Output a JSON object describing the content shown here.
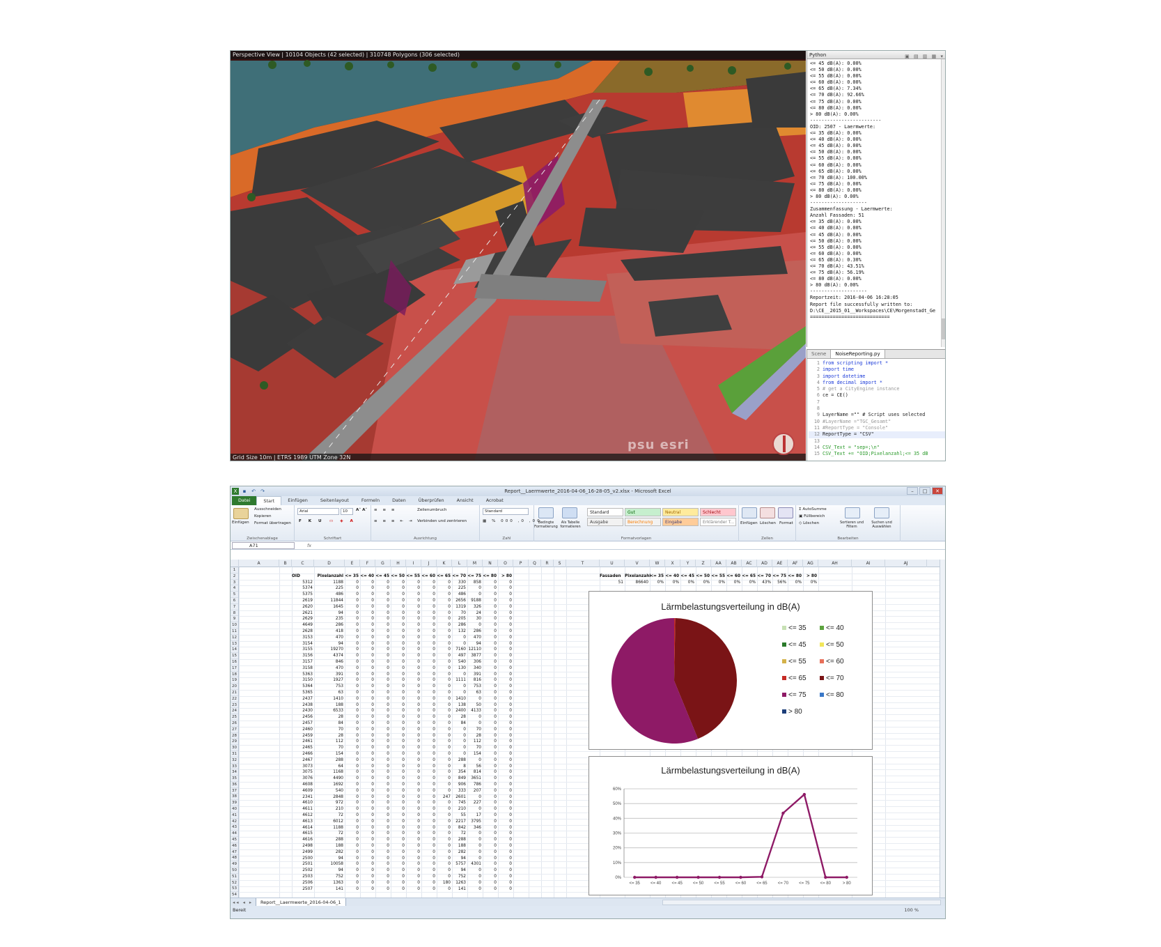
{
  "viewer": {
    "title": "Perspective View  |  10104 Objects  (42 selected)  |  310748 Polygons  (306 selected)",
    "status": "Grid Size 10m  |  ETRS 1989 UTM Zone 32N",
    "watermark": "psu  esri",
    "python_console": {
      "header": "Python",
      "lines": [
        "<= 45 dB(A): 0.00%",
        "<= 50 dB(A): 0.00%",
        "<= 55 dB(A): 0.00%",
        "<= 60 dB(A): 0.00%",
        "<= 65 dB(A): 7.34%",
        "<= 70 dB(A): 92.66%",
        "<= 75 dB(A): 0.00%",
        "<= 80 dB(A): 0.00%",
        "> 80 dB(A): 0.00%",
        "-------------------------",
        "OID: 2507 - Laermwerte:",
        "<= 35 dB(A): 0.00%",
        "<= 40 dB(A): 0.00%",
        "<= 45 dB(A): 0.00%",
        "<= 50 dB(A): 0.00%",
        "<= 55 dB(A): 0.00%",
        "<= 60 dB(A): 0.00%",
        "<= 65 dB(A): 0.00%",
        "<= 70 dB(A): 100.00%",
        "<= 75 dB(A): 0.00%",
        "<= 80 dB(A): 0.00%",
        "> 80 dB(A): 0.00%",
        "--------------------",
        "",
        "Zusammenfassung - Laermwerte:",
        "",
        "Anzahl Fassaden: 51",
        "<= 35 dB(A): 0.00%",
        "<= 40 dB(A): 0.00%",
        "<= 45 dB(A): 0.00%",
        "<= 50 dB(A): 0.00%",
        "<= 55 dB(A): 0.00%",
        "<= 60 dB(A): 0.00%",
        "<= 65 dB(A): 0.30%",
        "<= 70 dB(A): 43.51%",
        "<= 75 dB(A): 56.19%",
        "<= 80 dB(A): 0.00%",
        "> 80 dB(A): 0.00%",
        "--------------------",
        "",
        "Reportzeit: 2016-04-06 16:28:05",
        "",
        "Report file successfully written to:",
        "D:\\CE__2015_01__Workspaces\\CE\\Morgenstadt_Ge",
        "============================"
      ]
    },
    "script_editor": {
      "tabs": [
        "Scene",
        "NoiseReporting.py"
      ],
      "lines": [
        {
          "n": "1",
          "text": "from scripting import *",
          "kind": "kw"
        },
        {
          "n": "2",
          "text": "import time",
          "kind": "kw"
        },
        {
          "n": "3",
          "text": "import datetime",
          "kind": "kw"
        },
        {
          "n": "4",
          "text": "from decimal import *",
          "kind": "kw"
        },
        {
          "n": "5",
          "text": "# get a CityEngine instance",
          "kind": "cm"
        },
        {
          "n": "6",
          "text": "ce = CE()",
          "kind": ""
        },
        {
          "n": "7",
          "text": "",
          "kind": ""
        },
        {
          "n": "8",
          "text": "",
          "kind": ""
        },
        {
          "n": "9",
          "text": "LayerName =\"\" # Script uses selected",
          "kind": ""
        },
        {
          "n": "10",
          "text": "#LayerName =\"TGC_Gesamt\"",
          "kind": "cm"
        },
        {
          "n": "11",
          "text": "#ReportType = \"Console\"",
          "kind": "cm"
        },
        {
          "n": "12",
          "text": "ReportType = \"CSV\"",
          "kind": "hl"
        },
        {
          "n": "13",
          "text": "",
          "kind": ""
        },
        {
          "n": "14",
          "text": "CSV_Text = \"sep=;\\n\"",
          "kind": "st"
        },
        {
          "n": "15",
          "text": "CSV_Text += \"OID;Pixelanzahl;<= 35 dB",
          "kind": "st"
        }
      ]
    }
  },
  "excel": {
    "window_title": "Report__Laermwerte_2016-04-06_16-28-05_v2.xlsx - Microsoft Excel",
    "ribbon_tabs": [
      "Datei",
      "Start",
      "Einfügen",
      "Seitenlayout",
      "Formeln",
      "Daten",
      "Überprüfen",
      "Ansicht",
      "Acrobat"
    ],
    "ribbon": {
      "clipboard": {
        "paste": "Einfügen",
        "cut": "Ausschneiden",
        "copy": "Kopieren",
        "format": "Format übertragen",
        "label": "Zwischenablage"
      },
      "font": {
        "name": "Arial",
        "size": "10",
        "label": "Schriftart"
      },
      "alignment": {
        "wrap": "Zeilenumbruch",
        "merge": "Verbinden und zentrieren",
        "label": "Ausrichtung"
      },
      "number": {
        "format": "Standard",
        "label": "Zahl"
      },
      "styles": {
        "cond": "Bedingte Formatierung",
        "table": "Als Tabelle formatieren",
        "label": "Formatvorlagen",
        "boxes": [
          {
            "text": "Standard",
            "bg": "#ffffff",
            "fg": "#222222"
          },
          {
            "text": "Gut",
            "bg": "#c6efce",
            "fg": "#006100"
          },
          {
            "text": "Neutral",
            "bg": "#ffeb9c",
            "fg": "#9c6500"
          },
          {
            "text": "Schlecht",
            "bg": "#ffc7ce",
            "fg": "#9c0006"
          },
          {
            "text": "Ausgabe",
            "bg": "#f2f2f2",
            "fg": "#3f3f3f"
          },
          {
            "text": "Berechnung",
            "bg": "#f2f2f2",
            "fg": "#fa7d00"
          },
          {
            "text": "Eingabe",
            "bg": "#ffcc99",
            "fg": "#3f3f76"
          },
          {
            "text": "Erklärender T...",
            "bg": "#ffffff",
            "fg": "#7f7f7f"
          }
        ]
      },
      "cells": {
        "insert": "Einfügen",
        "delete": "Löschen",
        "format": "Format",
        "label": "Zellen"
      },
      "editing": {
        "autosum": "AutoSumme",
        "fill": "Füllbereich",
        "clear": "Löschen",
        "sort": "Sortieren und Filtern",
        "find": "Suchen und Auswählen",
        "label": "Bearbeiten"
      }
    },
    "name_box": "A71",
    "fx": "fx",
    "columns": [
      "A",
      "B",
      "C",
      "D",
      "E",
      "F",
      "G",
      "H",
      "I",
      "J",
      "K",
      "L",
      "M",
      "N",
      "O",
      "P",
      "Q",
      "R",
      "S",
      "T",
      "U",
      "V",
      "W",
      "X",
      "Y",
      "Z",
      "AA",
      "AB",
      "AC",
      "AD",
      "AE",
      "AF",
      "AG",
      "AH",
      "AI",
      "AJ"
    ],
    "table_headers": [
      "OID",
      "Pixelanzahl",
      "<= 35",
      "<= 40",
      "<= 45",
      "<= 50",
      "<= 55",
      "<= 60",
      "<= 65",
      "<= 70",
      "<= 75",
      "<= 80",
      "> 80"
    ],
    "rows": [
      [
        5312,
        1188,
        0,
        0,
        0,
        0,
        0,
        0,
        0,
        330,
        858,
        0,
        0
      ],
      [
        5374,
        225,
        0,
        0,
        0,
        0,
        0,
        0,
        0,
        225,
        0,
        0,
        0
      ],
      [
        5375,
        486,
        0,
        0,
        0,
        0,
        0,
        0,
        0,
        486,
        0,
        0,
        0
      ],
      [
        2619,
        11844,
        0,
        0,
        0,
        0,
        0,
        0,
        0,
        2656,
        9188,
        0,
        0
      ],
      [
        2620,
        1645,
        0,
        0,
        0,
        0,
        0,
        0,
        0,
        1319,
        326,
        0,
        0
      ],
      [
        2621,
        94,
        0,
        0,
        0,
        0,
        0,
        0,
        0,
        70,
        24,
        0,
        0
      ],
      [
        2629,
        235,
        0,
        0,
        0,
        0,
        0,
        0,
        0,
        205,
        30,
        0,
        0
      ],
      [
        4649,
        286,
        0,
        0,
        0,
        0,
        0,
        0,
        0,
        286,
        0,
        0,
        0
      ],
      [
        2628,
        418,
        0,
        0,
        0,
        0,
        0,
        0,
        0,
        132,
        286,
        0,
        0
      ],
      [
        3153,
        470,
        0,
        0,
        0,
        0,
        0,
        0,
        0,
        0,
        470,
        0,
        0
      ],
      [
        3154,
        94,
        0,
        0,
        0,
        0,
        0,
        0,
        0,
        0,
        94,
        0,
        0
      ],
      [
        3155,
        19270,
        0,
        0,
        0,
        0,
        0,
        0,
        0,
        7160,
        12110,
        0,
        0
      ],
      [
        3156,
        4374,
        0,
        0,
        0,
        0,
        0,
        0,
        0,
        497,
        3877,
        0,
        0
      ],
      [
        3157,
        846,
        0,
        0,
        0,
        0,
        0,
        0,
        0,
        540,
        306,
        0,
        0
      ],
      [
        3158,
        470,
        0,
        0,
        0,
        0,
        0,
        0,
        0,
        130,
        340,
        0,
        0
      ],
      [
        5363,
        391,
        0,
        0,
        0,
        0,
        0,
        0,
        0,
        0,
        391,
        0,
        0
      ],
      [
        3150,
        1927,
        0,
        0,
        0,
        0,
        0,
        0,
        0,
        1111,
        816,
        0,
        0
      ],
      [
        5364,
        753,
        0,
        0,
        0,
        0,
        0,
        0,
        0,
        0,
        753,
        0,
        0
      ],
      [
        5365,
        63,
        0,
        0,
        0,
        0,
        0,
        0,
        0,
        0,
        63,
        0,
        0
      ],
      [
        2437,
        1410,
        0,
        0,
        0,
        0,
        0,
        0,
        0,
        1410,
        0,
        0,
        0
      ],
      [
        2438,
        188,
        0,
        0,
        0,
        0,
        0,
        0,
        0,
        138,
        50,
        0,
        0
      ],
      [
        2430,
        6533,
        0,
        0,
        0,
        0,
        0,
        0,
        0,
        2400,
        4133,
        0,
        0
      ],
      [
        2456,
        28,
        0,
        0,
        0,
        0,
        0,
        0,
        0,
        28,
        0,
        0,
        0
      ],
      [
        2457,
        84,
        0,
        0,
        0,
        0,
        0,
        0,
        0,
        84,
        0,
        0,
        0
      ],
      [
        2460,
        70,
        0,
        0,
        0,
        0,
        0,
        0,
        0,
        0,
        70,
        0,
        0
      ],
      [
        2459,
        28,
        0,
        0,
        0,
        0,
        0,
        0,
        0,
        0,
        28,
        0,
        0
      ],
      [
        2461,
        112,
        0,
        0,
        0,
        0,
        0,
        0,
        0,
        0,
        112,
        0,
        0
      ],
      [
        2465,
        70,
        0,
        0,
        0,
        0,
        0,
        0,
        0,
        0,
        70,
        0,
        0
      ],
      [
        2466,
        154,
        0,
        0,
        0,
        0,
        0,
        0,
        0,
        0,
        154,
        0,
        0
      ],
      [
        2467,
        288,
        0,
        0,
        0,
        0,
        0,
        0,
        0,
        288,
        0,
        0,
        0
      ],
      [
        3073,
        64,
        0,
        0,
        0,
        0,
        0,
        0,
        0,
        8,
        56,
        0,
        0
      ],
      [
        3075,
        1168,
        0,
        0,
        0,
        0,
        0,
        0,
        0,
        354,
        814,
        0,
        0
      ],
      [
        3076,
        4490,
        0,
        0,
        0,
        0,
        0,
        0,
        0,
        849,
        3651,
        0,
        0
      ],
      [
        4608,
        1692,
        0,
        0,
        0,
        0,
        0,
        0,
        0,
        906,
        786,
        0,
        0
      ],
      [
        4609,
        540,
        0,
        0,
        0,
        0,
        0,
        0,
        0,
        333,
        207,
        0,
        0
      ],
      [
        2341,
        2848,
        0,
        0,
        0,
        0,
        0,
        0,
        247,
        2601,
        0,
        0,
        0
      ],
      [
        4610,
        972,
        0,
        0,
        0,
        0,
        0,
        0,
        0,
        745,
        227,
        0,
        0
      ],
      [
        4611,
        210,
        0,
        0,
        0,
        0,
        0,
        0,
        0,
        210,
        0,
        0,
        0
      ],
      [
        4612,
        72,
        0,
        0,
        0,
        0,
        0,
        0,
        0,
        55,
        17,
        0,
        0
      ],
      [
        4613,
        6012,
        0,
        0,
        0,
        0,
        0,
        0,
        0,
        2217,
        3795,
        0,
        0
      ],
      [
        4614,
        1188,
        0,
        0,
        0,
        0,
        0,
        0,
        0,
        842,
        346,
        0,
        0
      ],
      [
        4615,
        72,
        0,
        0,
        0,
        0,
        0,
        0,
        0,
        72,
        0,
        0,
        0
      ],
      [
        4616,
        288,
        0,
        0,
        0,
        0,
        0,
        0,
        0,
        288,
        0,
        0,
        0
      ],
      [
        2498,
        188,
        0,
        0,
        0,
        0,
        0,
        0,
        0,
        188,
        0,
        0,
        0
      ],
      [
        2499,
        282,
        0,
        0,
        0,
        0,
        0,
        0,
        0,
        282,
        0,
        0,
        0
      ],
      [
        2500,
        94,
        0,
        0,
        0,
        0,
        0,
        0,
        0,
        94,
        0,
        0,
        0
      ],
      [
        2501,
        10058,
        0,
        0,
        0,
        0,
        0,
        0,
        0,
        5757,
        4301,
        0,
        0
      ],
      [
        2502,
        94,
        0,
        0,
        0,
        0,
        0,
        0,
        0,
        94,
        0,
        0,
        0
      ],
      [
        2503,
        752,
        0,
        0,
        0,
        0,
        0,
        0,
        0,
        752,
        0,
        0,
        0
      ],
      [
        2506,
        1363,
        0,
        0,
        0,
        0,
        0,
        0,
        180,
        1263,
        0,
        0,
        0
      ],
      [
        2507,
        141,
        0,
        0,
        0,
        0,
        0,
        0,
        0,
        141,
        0,
        0,
        0
      ]
    ],
    "summary_headers": [
      "Fassaden",
      "Pixelanzahl",
      "<= 35",
      "<= 40",
      "<= 45",
      "<= 50",
      "<= 55",
      "<= 60",
      "<= 65",
      "<= 70",
      "<= 75",
      "<= 80",
      "> 80"
    ],
    "summary_values": [
      "51",
      "86640",
      "0%",
      "0%",
      "0%",
      "0%",
      "0%",
      "0%",
      "0%",
      "43%",
      "56%",
      "0%",
      "0%"
    ],
    "sheet_tab": "Report__Laermwerte_2016-04-06_1",
    "status": "Bereit",
    "zoom": "100 %"
  },
  "chart_data": [
    {
      "type": "pie",
      "title": "Lärmbelastungsverteilung in dB(A)",
      "categories": [
        "<= 35",
        "<= 40",
        "<= 45",
        "<= 50",
        "<= 55",
        "<= 60",
        "<= 65",
        "<= 70",
        "<= 75",
        "<= 80",
        "> 80"
      ],
      "values": [
        0,
        0,
        0,
        0,
        0,
        0,
        0.3,
        43.51,
        56.19,
        0,
        0
      ],
      "colors": [
        "#c7e0b4",
        "#5ca33e",
        "#2a7a2a",
        "#f2e65a",
        "#d4b24a",
        "#e8705a",
        "#c62b25",
        "#7a1416",
        "#8e1a66",
        "#3a78c8",
        "#1d3f7a"
      ],
      "legend_position": "right"
    },
    {
      "type": "line",
      "title": "Lärmbelastungsverteilung in dB(A)",
      "categories": [
        "<= 35",
        "<= 40",
        "<= 45",
        "<= 50",
        "<= 55",
        "<= 60",
        "<= 65",
        "<= 70",
        "<= 75",
        "<= 80",
        "> 80"
      ],
      "series": [
        {
          "values": [
            0,
            0,
            0,
            0,
            0,
            0,
            0.3,
            43.51,
            56.19,
            0,
            0
          ],
          "color": "#8e1a66"
        }
      ],
      "y_ticks": [
        "0%",
        "10%",
        "20%",
        "30%",
        "40%",
        "50%",
        "60%"
      ],
      "ylim": [
        0,
        60
      ],
      "grid": true
    }
  ]
}
